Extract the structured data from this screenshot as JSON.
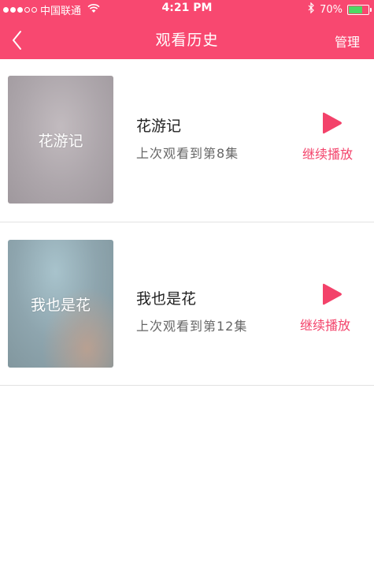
{
  "status_bar": {
    "carrier": "中国联通",
    "time": "4:21 PM",
    "battery": "70%",
    "battery_level": 0.7,
    "signal_bars_filled": 3,
    "signal_bars_total": 5
  },
  "header": {
    "title": "观看历史",
    "manage_label": "管理"
  },
  "history": [
    {
      "thumb_text": "花游记",
      "name": "花游记",
      "progress": "上次观看到第8集",
      "continue_label": "继续播放"
    },
    {
      "thumb_text": "我也是花",
      "name": "我也是花",
      "progress": "上次观看到第12集",
      "continue_label": "继续播放"
    }
  ],
  "colors": {
    "accent": "#f84870",
    "continue_text": "#f3426a",
    "battery_fill": "#4cd964"
  },
  "icons": [
    "signal-dots-icon",
    "wifi-icon",
    "bluetooth-icon",
    "battery-icon",
    "back-chevron-icon",
    "play-icon"
  ]
}
